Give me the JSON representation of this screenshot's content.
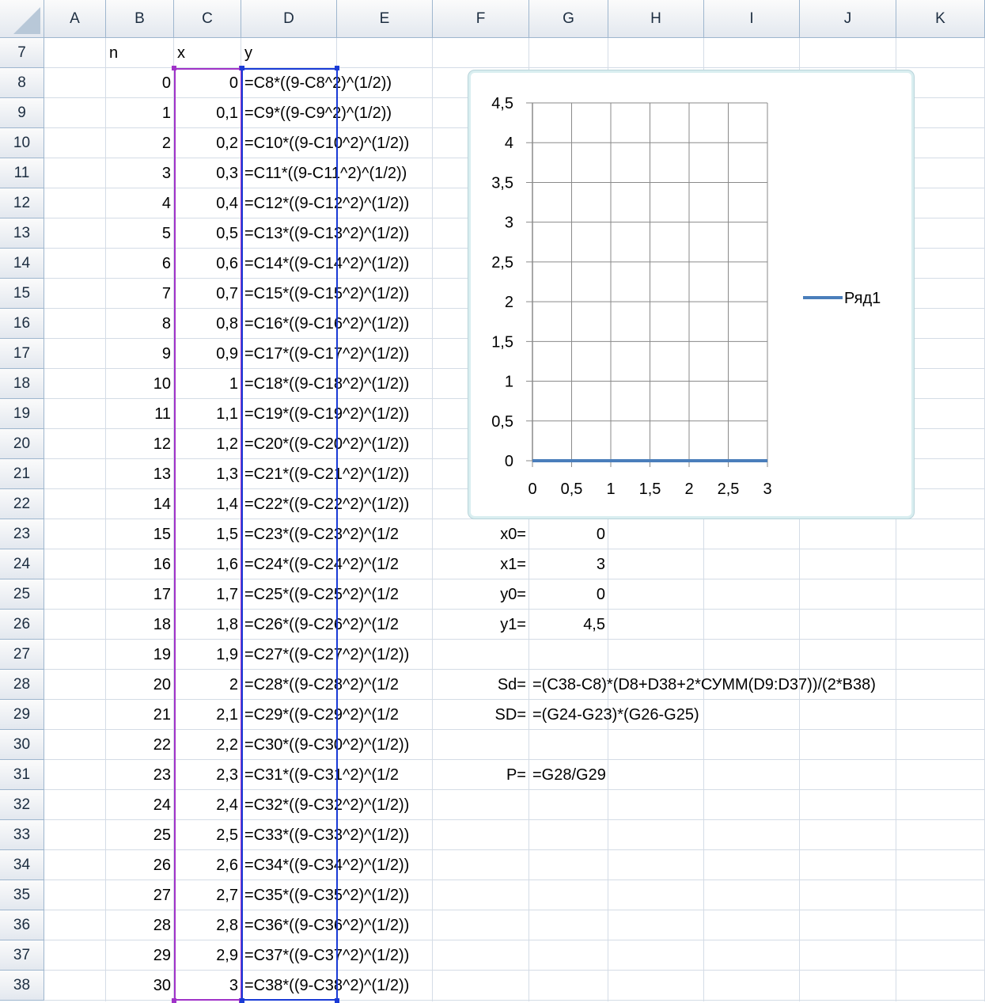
{
  "columns": [
    "A",
    "B",
    "C",
    "D",
    "E",
    "F",
    "G",
    "H",
    "I",
    "J",
    "K"
  ],
  "first_row": 7,
  "last_row": 38,
  "headers": {
    "n": "n",
    "x": "x",
    "y": "y"
  },
  "rows": [
    {
      "n": "0",
      "x": "0",
      "y": "=C8*((9-C8^2)^(1/2))"
    },
    {
      "n": "1",
      "x": "0,1",
      "y": "=C9*((9-C9^2)^(1/2))"
    },
    {
      "n": "2",
      "x": "0,2",
      "y": "=C10*((9-C10^2)^(1/2))"
    },
    {
      "n": "3",
      "x": "0,3",
      "y": "=C11*((9-C11^2)^(1/2))"
    },
    {
      "n": "4",
      "x": "0,4",
      "y": "=C12*((9-C12^2)^(1/2))"
    },
    {
      "n": "5",
      "x": "0,5",
      "y": "=C13*((9-C13^2)^(1/2))"
    },
    {
      "n": "6",
      "x": "0,6",
      "y": "=C14*((9-C14^2)^(1/2))"
    },
    {
      "n": "7",
      "x": "0,7",
      "y": "=C15*((9-C15^2)^(1/2))"
    },
    {
      "n": "8",
      "x": "0,8",
      "y": "=C16*((9-C16^2)^(1/2))"
    },
    {
      "n": "9",
      "x": "0,9",
      "y": "=C17*((9-C17^2)^(1/2))"
    },
    {
      "n": "10",
      "x": "1",
      "y": "=C18*((9-C18^2)^(1/2))"
    },
    {
      "n": "11",
      "x": "1,1",
      "y": "=C19*((9-C19^2)^(1/2))"
    },
    {
      "n": "12",
      "x": "1,2",
      "y": "=C20*((9-C20^2)^(1/2))"
    },
    {
      "n": "13",
      "x": "1,3",
      "y": "=C21*((9-C21^2)^(1/2))"
    },
    {
      "n": "14",
      "x": "1,4",
      "y": "=C22*((9-C22^2)^(1/2))"
    },
    {
      "n": "15",
      "x": "1,5",
      "y": "=C23*((9-C23^2)^(1/2"
    },
    {
      "n": "16",
      "x": "1,6",
      "y": "=C24*((9-C24^2)^(1/2"
    },
    {
      "n": "17",
      "x": "1,7",
      "y": "=C25*((9-C25^2)^(1/2"
    },
    {
      "n": "18",
      "x": "1,8",
      "y": "=C26*((9-C26^2)^(1/2"
    },
    {
      "n": "19",
      "x": "1,9",
      "y": "=C27*((9-C27^2)^(1/2))"
    },
    {
      "n": "20",
      "x": "2",
      "y": "=C28*((9-C28^2)^(1/2"
    },
    {
      "n": "21",
      "x": "2,1",
      "y": "=C29*((9-C29^2)^(1/2"
    },
    {
      "n": "22",
      "x": "2,2",
      "y": "=C30*((9-C30^2)^(1/2))"
    },
    {
      "n": "23",
      "x": "2,3",
      "y": "=C31*((9-C31^2)^(1/2"
    },
    {
      "n": "24",
      "x": "2,4",
      "y": "=C32*((9-C32^2)^(1/2))"
    },
    {
      "n": "25",
      "x": "2,5",
      "y": "=C33*((9-C33^2)^(1/2))"
    },
    {
      "n": "26",
      "x": "2,6",
      "y": "=C34*((9-C34^2)^(1/2))"
    },
    {
      "n": "27",
      "x": "2,7",
      "y": "=C35*((9-C35^2)^(1/2))"
    },
    {
      "n": "28",
      "x": "2,8",
      "y": "=C36*((9-C36^2)^(1/2))"
    },
    {
      "n": "29",
      "x": "2,9",
      "y": "=C37*((9-C37^2)^(1/2))"
    },
    {
      "n": "30",
      "x": "3",
      "y": "=C38*((9-C38^2)^(1/2))"
    }
  ],
  "params": [
    {
      "label": "x0=",
      "value": "0"
    },
    {
      "label": "x1=",
      "value": "3"
    },
    {
      "label": "y0=",
      "value": "0"
    },
    {
      "label": "y1=",
      "value": "4,5"
    }
  ],
  "formulas": {
    "sd_label": "Sd=",
    "sd_value": "=(C38-C8)*(D8+D38+2*СУММ(D9:D37))/(2*B38)",
    "sd2_label": "SD=",
    "sd2_value": "=(G24-G23)*(G26-G25)",
    "p_label": "P=",
    "p_value": "=G28/G29"
  },
  "colors": {
    "x_selection": "#a033c8",
    "y_selection": "#1a3bd6",
    "series": "#4a7ebb"
  },
  "chart_data": {
    "type": "line",
    "x_ticks": [
      "0",
      "0,5",
      "1",
      "1,5",
      "2",
      "2,5",
      "3"
    ],
    "y_ticks": [
      "0",
      "0,5",
      "1",
      "1,5",
      "2",
      "2,5",
      "3",
      "3,5",
      "4",
      "4,5"
    ],
    "xlim": [
      0,
      3
    ],
    "ylim": [
      0,
      4.5
    ],
    "grid": true,
    "legend_position": "right",
    "series": [
      {
        "name": "Ряд1",
        "x": [
          0,
          3
        ],
        "y": [
          0,
          0
        ]
      }
    ]
  }
}
